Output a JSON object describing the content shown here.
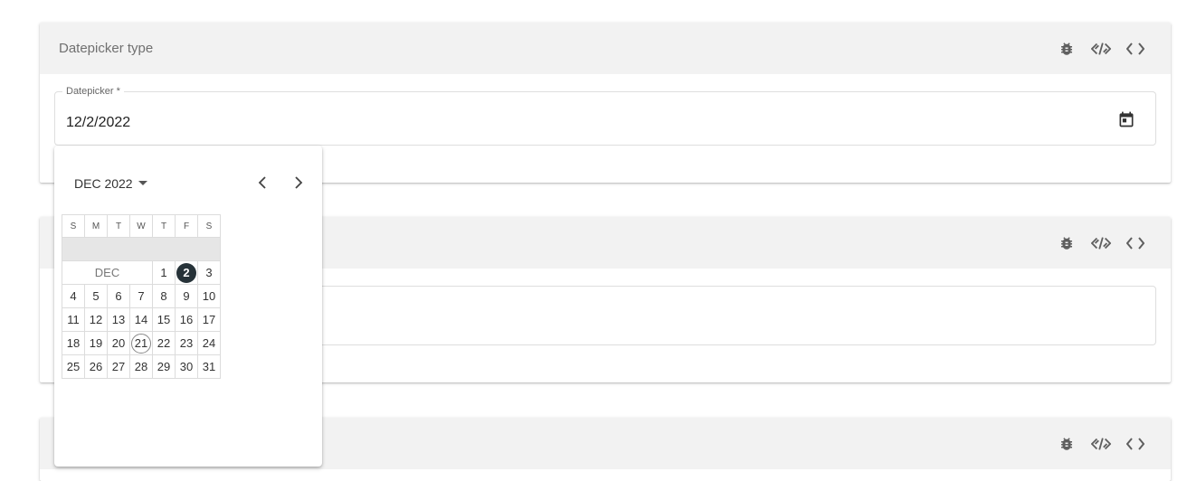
{
  "cards": [
    {
      "title": "Datepicker type"
    },
    {
      "title": ""
    },
    {
      "title": ""
    }
  ],
  "field": {
    "legend": "Datepicker *",
    "value": "12/2/2022"
  },
  "icons": {
    "header": [
      "bug-icon",
      "code-link-icon",
      "code-icon"
    ],
    "field_action": "calendar-icon"
  },
  "datepicker": {
    "period_label": "DEC 2022",
    "weekdays": [
      "S",
      "M",
      "T",
      "W",
      "T",
      "F",
      "S"
    ],
    "month_label": "DEC",
    "first_week": [
      "1",
      "2",
      "3"
    ],
    "weeks": [
      [
        "4",
        "5",
        "6",
        "7",
        "8",
        "9",
        "10"
      ],
      [
        "11",
        "12",
        "13",
        "14",
        "15",
        "16",
        "17"
      ],
      [
        "18",
        "19",
        "20",
        "21",
        "22",
        "23",
        "24"
      ],
      [
        "25",
        "26",
        "27",
        "28",
        "29",
        "30",
        "31"
      ]
    ],
    "selected_day": "2",
    "today_day": "21"
  },
  "colors": {
    "header_bg": "#f2f2f2",
    "selected_bg": "#263238",
    "icon": "#5f5f5f"
  }
}
